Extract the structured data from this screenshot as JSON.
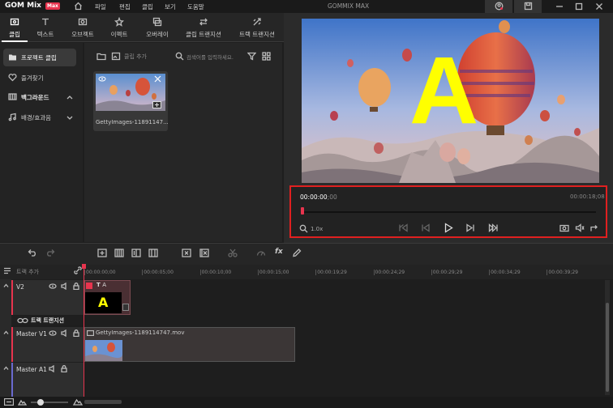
{
  "titlebar": {
    "logo": "GOM Mix",
    "logo_badge": "Max",
    "menus": [
      "파일",
      "편집",
      "클립",
      "보기",
      "도움말"
    ],
    "window_title": "GOMMIX MAX"
  },
  "tabs": [
    {
      "label": "클립",
      "icon": "clip-icon",
      "active": true
    },
    {
      "label": "텍스트",
      "icon": "text-icon"
    },
    {
      "label": "오브젝트",
      "icon": "object-icon"
    },
    {
      "label": "이펙트",
      "icon": "effect-icon"
    },
    {
      "label": "오버레이",
      "icon": "overlay-icon"
    },
    {
      "label": "클립 트랜지션",
      "icon": "clip-transition-icon"
    },
    {
      "label": "트랙 트랜지션",
      "icon": "track-transition-icon"
    }
  ],
  "sidebar": {
    "items": [
      {
        "label": "프로젝트 클립",
        "icon": "folder-icon",
        "active": true
      },
      {
        "label": "즐겨찾기",
        "icon": "heart-icon"
      },
      {
        "label": "백그라운드",
        "icon": "background-icon"
      },
      {
        "label": "배경/효과음",
        "icon": "music-icon"
      }
    ]
  },
  "content": {
    "add_clip": "클립 추가",
    "search_placeholder": "검색어를 입력하세요.",
    "clip_name": "GettyImages-11891147..."
  },
  "preview": {
    "overlay_letter": "A",
    "current_time": "00:00:00",
    "current_frames": ";00",
    "total_time": "00:00:18;08",
    "zoom": "1.0x"
  },
  "timeline": {
    "track_transition_label": "트랙 추가",
    "ruler_ticks": [
      "00:00:00;00",
      "00:00:05;00",
      "00:00:10;00",
      "00:00:15;00",
      "00:00:19;29",
      "00:00:24;29",
      "00:00:29;29",
      "00:00:34;29",
      "00:00:39;29"
    ],
    "tracks": [
      {
        "name": "V2"
      },
      {
        "name": "트랙 트랜지션"
      },
      {
        "name": "Master V1"
      },
      {
        "name": "Master A1"
      }
    ],
    "text_clip_label": "A",
    "text_clip_letter": "A",
    "video_clip_name": "GettyImages-1189114747.mov"
  },
  "colors": {
    "accent": "#e8344e",
    "highlight": "#e02020",
    "letter": "#ffff00"
  }
}
